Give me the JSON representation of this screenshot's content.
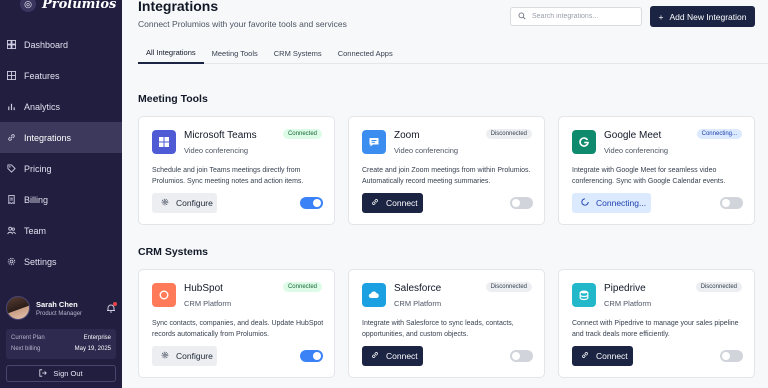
{
  "brand": {
    "name": "Prolumios"
  },
  "nav": [
    {
      "label": "Dashboard",
      "icon": "dashboard-icon"
    },
    {
      "label": "Features",
      "icon": "features-icon"
    },
    {
      "label": "Analytics",
      "icon": "analytics-icon"
    },
    {
      "label": "Integrations",
      "icon": "link-icon",
      "active": true
    },
    {
      "label": "Pricing",
      "icon": "tag-icon"
    },
    {
      "label": "Billing",
      "icon": "receipt-icon"
    },
    {
      "label": "Team",
      "icon": "team-icon"
    },
    {
      "label": "Settings",
      "icon": "gear-icon"
    }
  ],
  "user": {
    "name": "Sarah Chen",
    "role": "Product Manager",
    "plan_label": "Current Plan",
    "plan_value": "Enterprise",
    "billing_label": "Next billing",
    "billing_value": "May 19, 2025",
    "signout": "Sign Out"
  },
  "header": {
    "title": "Integrations",
    "subtitle": "Connect Prolumios with your favorite tools and services",
    "search_placeholder": "Search integrations...",
    "add_button": "Add New Integration"
  },
  "tabs": [
    "All Integrations",
    "Meeting Tools",
    "CRM Systems",
    "Connected Apps"
  ],
  "sections": [
    {
      "title": "Meeting Tools",
      "cards": [
        {
          "name": "Microsoft Teams",
          "category": "Video conferencing",
          "status": "Connected",
          "desc": "Schedule and join Teams meetings directly from Prolumios. Sync meeting notes and action items.",
          "action": "Configure",
          "toggle": true,
          "icon_color": "#4f5bd5",
          "icon": "teams-icon"
        },
        {
          "name": "Zoom",
          "category": "Video conferencing",
          "status": "Disconnected",
          "desc": "Create and join Zoom meetings from within Prolumios. Automatically record meeting summaries.",
          "action": "Connect",
          "toggle": false,
          "icon_color": "#3b8ef0",
          "icon": "chat-icon"
        },
        {
          "name": "Google Meet",
          "category": "Video conferencing",
          "status": "Connecting...",
          "desc": "Integrate with Google Meet for seamless video conferencing. Sync with Google Calendar events.",
          "action": "Connecting...",
          "toggle": false,
          "icon_color": "#0f8a6c",
          "icon": "google-icon"
        }
      ]
    },
    {
      "title": "CRM Systems",
      "cards": [
        {
          "name": "HubSpot",
          "category": "CRM Platform",
          "status": "Connected",
          "desc": "Sync contacts, companies, and deals. Update HubSpot records automatically from Prolumios.",
          "action": "Configure",
          "toggle": true,
          "icon_color": "#ff7a59",
          "icon": "hubspot-icon"
        },
        {
          "name": "Salesforce",
          "category": "CRM Platform",
          "status": "Disconnected",
          "desc": "Integrate with Salesforce to sync leads, contacts, opportunities, and custom objects.",
          "action": "Connect",
          "toggle": false,
          "icon_color": "#1ba1e2",
          "icon": "cloud-icon"
        },
        {
          "name": "Pipedrive",
          "category": "CRM Platform",
          "status": "Disconnected",
          "desc": "Connect with Pipedrive to manage your sales pipeline and track deals more efficiently.",
          "action": "Connect",
          "toggle": false,
          "icon_color": "#22b8c9",
          "icon": "database-icon"
        }
      ]
    }
  ]
}
